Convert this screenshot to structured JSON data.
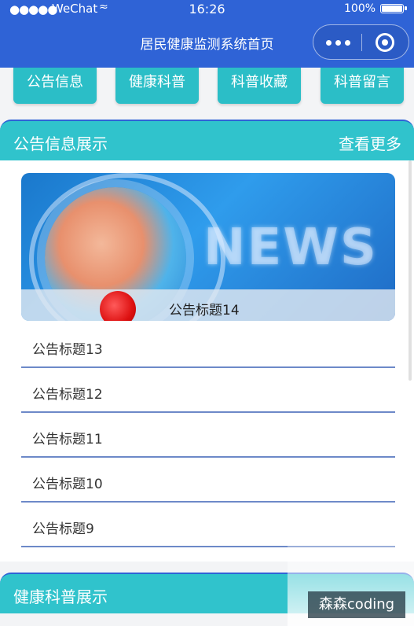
{
  "status_bar": {
    "signal": "●●●●●",
    "carrier": "WeChat",
    "time": "16:26",
    "battery": "100%"
  },
  "navbar": {
    "title": "居民健康监测系统首页"
  },
  "top_nav": [
    "公告信息",
    "健康科普",
    "科普收藏",
    "科普留言"
  ],
  "notice_section": {
    "title": "公告信息展示",
    "more": "查看更多",
    "banner_caption": "公告标题14",
    "banner_word": "NEWS",
    "items": [
      "公告标题13",
      "公告标题12",
      "公告标题11",
      "公告标题10",
      "公告标题9"
    ]
  },
  "health_section": {
    "title": "健康科普展示"
  },
  "watermark": "森森coding",
  "colors": {
    "nav_blue": "#2f63d6",
    "teal": "#2bbec7",
    "divider": "#6d89c8"
  }
}
